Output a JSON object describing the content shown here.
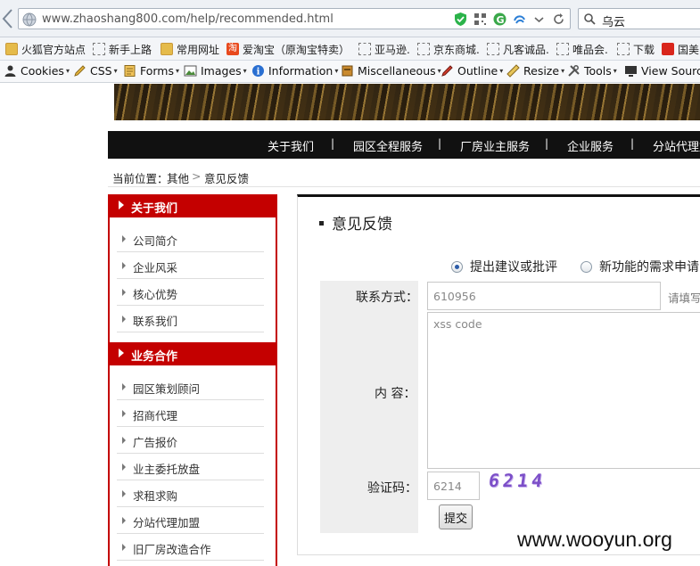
{
  "browser": {
    "url": "www.zhaoshang800.com/help/recommended.html",
    "search_value": "乌云",
    "bookmarks": [
      "火狐官方站点",
      "新手上路",
      "常用网址",
      "爱淘宝（原淘宝特卖）",
      "亚马逊.",
      "京东商城.",
      "凡客诚品.",
      "唯品会.",
      "下载",
      "国美"
    ],
    "devtools": [
      "Cookies",
      "CSS",
      "Forms",
      "Images",
      "Information",
      "Miscellaneous",
      "Outline",
      "Resize",
      "Tools",
      "View Sourc"
    ]
  },
  "nav": {
    "items": [
      "关于我们",
      "园区全程服务",
      "厂房业主服务",
      "企业服务",
      "分站代理加"
    ],
    "separator": "|"
  },
  "breadcrumb": {
    "prefix": "当前位置：",
    "section": "其他",
    "arrow": ">",
    "current": "意见反馈"
  },
  "sidebar": {
    "groups": [
      {
        "title": "关于我们",
        "items": [
          "公司简介",
          "企业风采",
          "核心优势",
          "联系我们"
        ]
      },
      {
        "title": "业务合作",
        "items": [
          "园区策划顾问",
          "招商代理",
          "广告报价",
          "业主委托放盘",
          "求租求购",
          "分站代理加盟",
          "旧厂房改造合作"
        ]
      }
    ]
  },
  "main": {
    "title": "意见反馈",
    "radio_options": [
      {
        "label": "提出建议或批评",
        "checked": true
      },
      {
        "label": "新功能的需求申请",
        "checked": false
      }
    ],
    "contact_label": "联系方式：",
    "contact_value": "610956",
    "contact_hint": "请填写",
    "content_label": "内  容：",
    "content_value": "xss code",
    "captcha_label": "验证码：",
    "captcha_value": "6214",
    "captcha_image_text": "6214",
    "submit_label": "提交"
  },
  "watermark": "www.wooyun.org",
  "colors": {
    "accent_red": "#c40000",
    "nav_bg": "#111111",
    "captcha_purple": "#7c4fc8"
  }
}
